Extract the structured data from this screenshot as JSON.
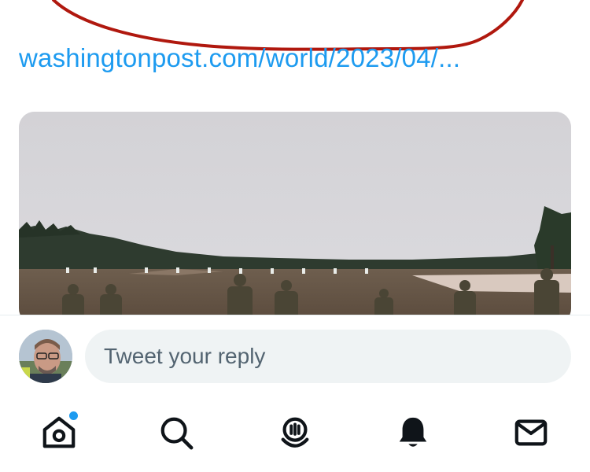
{
  "tweet": {
    "link_text": "washingtonpost.com/world/2023/04/..."
  },
  "media": {
    "description_icon": "photo-soldiers-training-field"
  },
  "reply": {
    "placeholder": "Tweet your reply",
    "avatar_icon": "user-avatar"
  },
  "tabbar": {
    "items": [
      {
        "icon": "home-icon",
        "has_notification_dot": true
      },
      {
        "icon": "search-icon"
      },
      {
        "icon": "spaces-icon"
      },
      {
        "icon": "bell-icon"
      },
      {
        "icon": "mail-icon"
      }
    ]
  },
  "colors": {
    "link": "#1d9bf0",
    "annotation": "#b0180e",
    "input_bg": "#eff3f4",
    "placeholder": "#536471",
    "notification_dot": "#1d9bf0"
  }
}
